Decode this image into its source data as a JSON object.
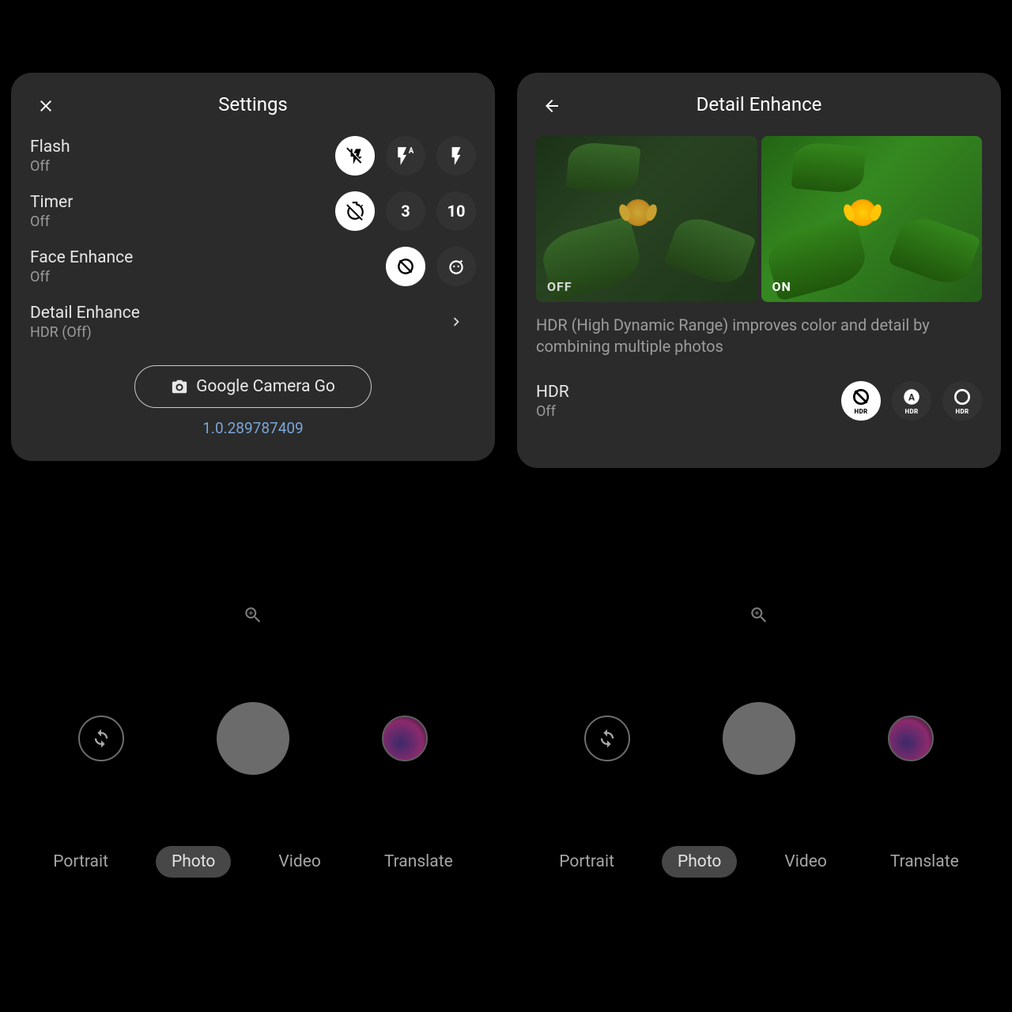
{
  "left": {
    "title": "Settings",
    "rows": {
      "flash": {
        "label": "Flash",
        "value": "Off"
      },
      "timer": {
        "label": "Timer",
        "value": "Off",
        "opt3": "3",
        "opt10": "10"
      },
      "face": {
        "label": "Face Enhance",
        "value": "Off"
      },
      "detail": {
        "label": "Detail Enhance",
        "value": "HDR (Off)"
      }
    },
    "app_button": "Google Camera Go",
    "version": "1.0.289787409"
  },
  "right": {
    "title": "Detail Enhance",
    "tag_off": "OFF",
    "tag_on": "ON",
    "description": "HDR (High Dynamic Range) improves color and detail by combining multiple photos",
    "hdr": {
      "label": "HDR",
      "value": "Off",
      "opt_label": "HDR"
    }
  },
  "modes": {
    "portrait": "Portrait",
    "photo": "Photo",
    "video": "Video",
    "translate": "Translate"
  }
}
